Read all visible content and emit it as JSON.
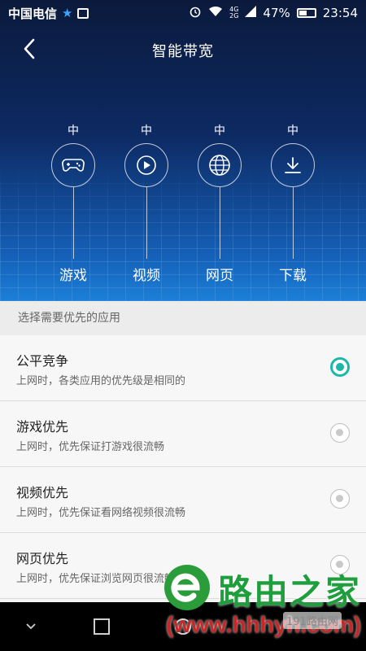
{
  "status_bar": {
    "carrier": "中国电信",
    "network_badge_top": "4G",
    "network_badge_bottom": "2G",
    "battery": "47%",
    "time": "23:54"
  },
  "header": {
    "title": "智能带宽"
  },
  "apps": [
    {
      "level": "中",
      "label": "游戏",
      "icon": "gamepad-icon"
    },
    {
      "level": "中",
      "label": "视频",
      "icon": "play-icon"
    },
    {
      "level": "中",
      "label": "网页",
      "icon": "globe-icon"
    },
    {
      "level": "中",
      "label": "下载",
      "icon": "download-icon"
    }
  ],
  "section": {
    "title": "选择需要优先的应用"
  },
  "options": [
    {
      "title": "公平竞争",
      "desc": "上网时，各类应用的优先级是相同的",
      "selected": true
    },
    {
      "title": "游戏优先",
      "desc": "上网时，优先保证打游戏很流畅",
      "selected": false
    },
    {
      "title": "视频优先",
      "desc": "上网时，优先保证看网络视频很流畅",
      "selected": false
    },
    {
      "title": "网页优先",
      "desc": "上网时，优先保证浏览网页很流畅",
      "selected": false
    }
  ],
  "watermark": {
    "brand": "路由之家",
    "url": "(www.hhhyh.com)",
    "badge": "191路由网"
  },
  "colors": {
    "accent": "#1db6aa",
    "hero_dark": "#0b1a3c",
    "hero_light": "#1c7fd6"
  }
}
